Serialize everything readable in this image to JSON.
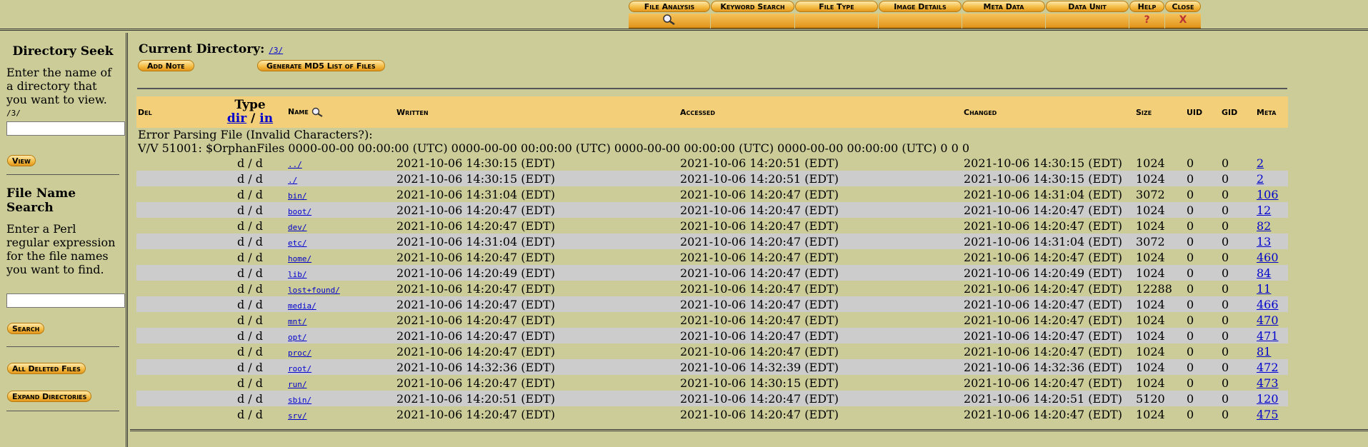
{
  "tabs": [
    {
      "label": "File Analysis",
      "icon": "search-icon"
    },
    {
      "label": "Keyword Search"
    },
    {
      "label": "File Type"
    },
    {
      "label": "Image Details"
    },
    {
      "label": "Meta Data"
    },
    {
      "label": "Data Unit"
    },
    {
      "label": "Help",
      "under": "?"
    },
    {
      "label": "Close",
      "under": "X"
    }
  ],
  "sidebar": {
    "dir_seek_title": "Directory Seek",
    "dir_seek_desc": "Enter the name of a directory that you want to view.",
    "dir_seek_path": "/3/",
    "dir_seek_value": "",
    "view_label": "View",
    "file_search_title": "File Name Search",
    "file_search_desc": "Enter a Perl regular expression for the file names you want to find.",
    "file_search_value": "",
    "search_label": "Search",
    "all_deleted_label": "All Deleted Files",
    "expand_dirs_label": "Expand Directories"
  },
  "main": {
    "current_dir_label": "Current Directory:",
    "current_dir_path": "/3/",
    "add_note_label": "Add Note",
    "md5_label": "Generate MD5 List of Files",
    "columns": {
      "del": "Del",
      "type": "Type",
      "type_dir": "dir",
      "type_sep": " / ",
      "type_in": "in",
      "name": "Name",
      "written": "Written",
      "accessed": "Accessed",
      "changed": "Changed",
      "size": "Size",
      "uid": "UID",
      "gid": "GID",
      "meta": "Meta"
    },
    "error_line1": "Error Parsing File (Invalid Characters?):",
    "error_line2": "V/V 51001: $OrphanFiles 0000-00-00 00:00:00 (UTC) 0000-00-00 00:00:00 (UTC) 0000-00-00 00:00:00 (UTC) 0000-00-00 00:00:00 (UTC) 0 0 0",
    "rows": [
      {
        "type": "d / d",
        "name": "../",
        "written": "2021-10-06 14:30:15 (EDT)",
        "accessed": "2021-10-06 14:20:51 (EDT)",
        "changed": "2021-10-06 14:30:15 (EDT)",
        "size": "1024",
        "uid": "0",
        "gid": "0",
        "meta": "2"
      },
      {
        "type": "d / d",
        "name": "./",
        "written": "2021-10-06 14:30:15 (EDT)",
        "accessed": "2021-10-06 14:20:51 (EDT)",
        "changed": "2021-10-06 14:30:15 (EDT)",
        "size": "1024",
        "uid": "0",
        "gid": "0",
        "meta": "2"
      },
      {
        "type": "d / d",
        "name": "bin/",
        "written": "2021-10-06 14:31:04 (EDT)",
        "accessed": "2021-10-06 14:20:47 (EDT)",
        "changed": "2021-10-06 14:31:04 (EDT)",
        "size": "3072",
        "uid": "0",
        "gid": "0",
        "meta": "106"
      },
      {
        "type": "d / d",
        "name": "boot/",
        "written": "2021-10-06 14:20:47 (EDT)",
        "accessed": "2021-10-06 14:20:47 (EDT)",
        "changed": "2021-10-06 14:20:47 (EDT)",
        "size": "1024",
        "uid": "0",
        "gid": "0",
        "meta": "12"
      },
      {
        "type": "d / d",
        "name": "dev/",
        "written": "2021-10-06 14:20:47 (EDT)",
        "accessed": "2021-10-06 14:20:47 (EDT)",
        "changed": "2021-10-06 14:20:47 (EDT)",
        "size": "1024",
        "uid": "0",
        "gid": "0",
        "meta": "82"
      },
      {
        "type": "d / d",
        "name": "etc/",
        "written": "2021-10-06 14:31:04 (EDT)",
        "accessed": "2021-10-06 14:20:47 (EDT)",
        "changed": "2021-10-06 14:31:04 (EDT)",
        "size": "3072",
        "uid": "0",
        "gid": "0",
        "meta": "13"
      },
      {
        "type": "d / d",
        "name": "home/",
        "written": "2021-10-06 14:20:47 (EDT)",
        "accessed": "2021-10-06 14:20:47 (EDT)",
        "changed": "2021-10-06 14:20:47 (EDT)",
        "size": "1024",
        "uid": "0",
        "gid": "0",
        "meta": "460"
      },
      {
        "type": "d / d",
        "name": "lib/",
        "written": "2021-10-06 14:20:49 (EDT)",
        "accessed": "2021-10-06 14:20:47 (EDT)",
        "changed": "2021-10-06 14:20:49 (EDT)",
        "size": "1024",
        "uid": "0",
        "gid": "0",
        "meta": "84"
      },
      {
        "type": "d / d",
        "name": "lost+found/",
        "written": "2021-10-06 14:20:47 (EDT)",
        "accessed": "2021-10-06 14:20:47 (EDT)",
        "changed": "2021-10-06 14:20:47 (EDT)",
        "size": "12288",
        "uid": "0",
        "gid": "0",
        "meta": "11"
      },
      {
        "type": "d / d",
        "name": "media/",
        "written": "2021-10-06 14:20:47 (EDT)",
        "accessed": "2021-10-06 14:20:47 (EDT)",
        "changed": "2021-10-06 14:20:47 (EDT)",
        "size": "1024",
        "uid": "0",
        "gid": "0",
        "meta": "466"
      },
      {
        "type": "d / d",
        "name": "mnt/",
        "written": "2021-10-06 14:20:47 (EDT)",
        "accessed": "2021-10-06 14:20:47 (EDT)",
        "changed": "2021-10-06 14:20:47 (EDT)",
        "size": "1024",
        "uid": "0",
        "gid": "0",
        "meta": "470"
      },
      {
        "type": "d / d",
        "name": "opt/",
        "written": "2021-10-06 14:20:47 (EDT)",
        "accessed": "2021-10-06 14:20:47 (EDT)",
        "changed": "2021-10-06 14:20:47 (EDT)",
        "size": "1024",
        "uid": "0",
        "gid": "0",
        "meta": "471"
      },
      {
        "type": "d / d",
        "name": "proc/",
        "written": "2021-10-06 14:20:47 (EDT)",
        "accessed": "2021-10-06 14:20:47 (EDT)",
        "changed": "2021-10-06 14:20:47 (EDT)",
        "size": "1024",
        "uid": "0",
        "gid": "0",
        "meta": "81"
      },
      {
        "type": "d / d",
        "name": "root/",
        "written": "2021-10-06 14:32:36 (EDT)",
        "accessed": "2021-10-06 14:32:39 (EDT)",
        "changed": "2021-10-06 14:32:36 (EDT)",
        "size": "1024",
        "uid": "0",
        "gid": "0",
        "meta": "472"
      },
      {
        "type": "d / d",
        "name": "run/",
        "written": "2021-10-06 14:20:47 (EDT)",
        "accessed": "2021-10-06 14:30:15 (EDT)",
        "changed": "2021-10-06 14:20:47 (EDT)",
        "size": "1024",
        "uid": "0",
        "gid": "0",
        "meta": "473"
      },
      {
        "type": "d / d",
        "name": "sbin/",
        "written": "2021-10-06 14:20:51 (EDT)",
        "accessed": "2021-10-06 14:20:47 (EDT)",
        "changed": "2021-10-06 14:20:51 (EDT)",
        "size": "5120",
        "uid": "0",
        "gid": "0",
        "meta": "120"
      },
      {
        "type": "d / d",
        "name": "srv/",
        "written": "2021-10-06 14:20:47 (EDT)",
        "accessed": "2021-10-06 14:20:47 (EDT)",
        "changed": "2021-10-06 14:20:47 (EDT)",
        "size": "1024",
        "uid": "0",
        "gid": "0",
        "meta": "475"
      }
    ]
  },
  "colors": {
    "background": "#cccc99",
    "row_alt": "#cccccc",
    "header": "#f3cf7a",
    "button": "#f3b93f",
    "link": "#0000cc"
  }
}
